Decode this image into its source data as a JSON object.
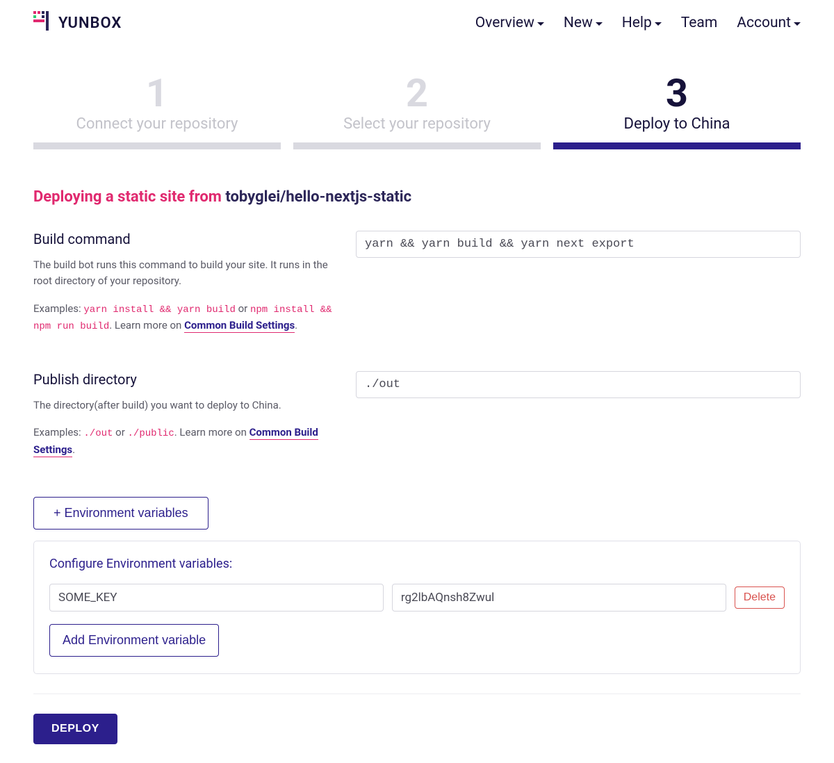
{
  "brand": "YUNBOX",
  "nav": {
    "overview": "Overview",
    "new": "New",
    "help": "Help",
    "team": "Team",
    "account": "Account"
  },
  "steps": [
    {
      "num": "1",
      "label": "Connect your repository",
      "active": false
    },
    {
      "num": "2",
      "label": "Select your repository",
      "active": false
    },
    {
      "num": "3",
      "label": "Deploy to China",
      "active": true
    }
  ],
  "heading": {
    "prefix": "Deploying a static site from ",
    "repo": "tobyglei/hello-nextjs-static"
  },
  "build_command": {
    "label": "Build command",
    "help1": "The build bot runs this command to build your site. It runs in the root directory of your repository.",
    "examples_prefix": "Examples: ",
    "example1": "yarn install && yarn build",
    "or": " or ",
    "example2": "npm install && npm run build",
    "learn": ". Learn more on ",
    "link": "Common Build Settings",
    "period": ".",
    "value": "yarn && yarn build && yarn next export"
  },
  "publish_dir": {
    "label": "Publish directory",
    "help1": "The directory(after build) you want to deploy to China.",
    "examples_prefix": "Examples: ",
    "example1": "./out",
    "or": " or ",
    "example2": "./public",
    "learn": ". Learn more on ",
    "link": "Common Build Settings",
    "period": ".",
    "value": "./out"
  },
  "env": {
    "toggle": "+ Environment variables",
    "title": "Configure Environment variables:",
    "rows": [
      {
        "key": "SOME_KEY",
        "value": "rg2lbAQnsh8Zwul"
      }
    ],
    "delete": "Delete",
    "add": "Add Environment variable"
  },
  "deploy": "DEPLOY"
}
